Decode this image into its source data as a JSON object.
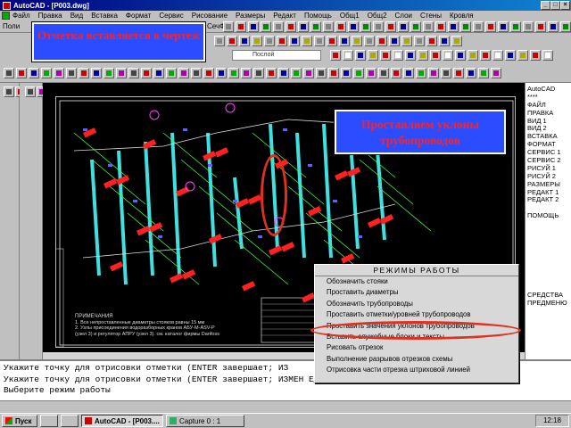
{
  "window": {
    "title": "AutoCAD - [P003.dwg]"
  },
  "menu": [
    "Файл",
    "Правка",
    "Вид",
    "Вставка",
    "Формат",
    "Сервис",
    "Рисование",
    "Размеры",
    "Редакт",
    "Помощь",
    "Общ1",
    "Общ2",
    "Слои",
    "Стены",
    "Кровля"
  ],
  "toolbar": {
    "row1_left": "Поли",
    "row1_right": "СечФ",
    "layer_name": "Послой"
  },
  "callouts": {
    "mark_inserted": "Отметка вставляется в чертеж",
    "slope_label": "Проставляем уклоны трубопроводов"
  },
  "side_menu": [
    "AutoCAD",
    "****",
    "ФАЙЛ",
    "ПРАВКА",
    "ВИД 1",
    "ВИД 2",
    "ВСТАВКА",
    "ФОРМАТ",
    "СЕРВИС 1",
    "СЕРВИС 2",
    "РИСУЙ 1",
    "РИСУЙ 2",
    "РАЗМЕРЫ",
    "РЕДАКТ 1",
    "РЕДАКТ 2",
    "",
    "ПОМОЩЬ",
    "",
    "",
    "",
    "",
    "",
    "",
    "",
    "",
    "",
    "СРЕДСТВА",
    "ПРЕДМЕНЮ"
  ],
  "popup": {
    "title": "РЕЖИМЫ РАБОТЫ",
    "items": [
      "Обозначить стояки",
      "Проставить диаметры",
      "Обозначить трубопроводы",
      "Проставить отметки/уровней трубопроводов",
      "Проставить значения уклонов трубопроводов",
      "Вставить служебные блоки и тексты",
      "Рисовать отрезок",
      "Выполнение разрывов отрезков схемы",
      "Отрисовка части отрезка штриховой линией"
    ],
    "highlighted_index": 4
  },
  "notes": {
    "title": "ПРИМЕЧАНИЯ",
    "lines": [
      "1. Все непроставленные диаметры стояков равны 15 мм",
      "2. Узлы присоединения водоразборных кранов АБУ-М-ASV-P",
      "(узел 3) и регулятор АПРУ (узел 3). см. каталог фирмы Danfoss"
    ]
  },
  "command_line": [
    "Укажите точку для отрисовки отметки (ENTER завершает; ИЗ",
    "Укажите точку для отрисовки отметки (ENTER завершает; ИЗМЕН ЕДИНИЦЫ):",
    "Выберите режим работы"
  ],
  "taskbar": {
    "start": "Пуск",
    "buttons": [
      "AutoCAD - [P003....",
      "Capture 0 : 1"
    ],
    "clock": "12:18"
  }
}
